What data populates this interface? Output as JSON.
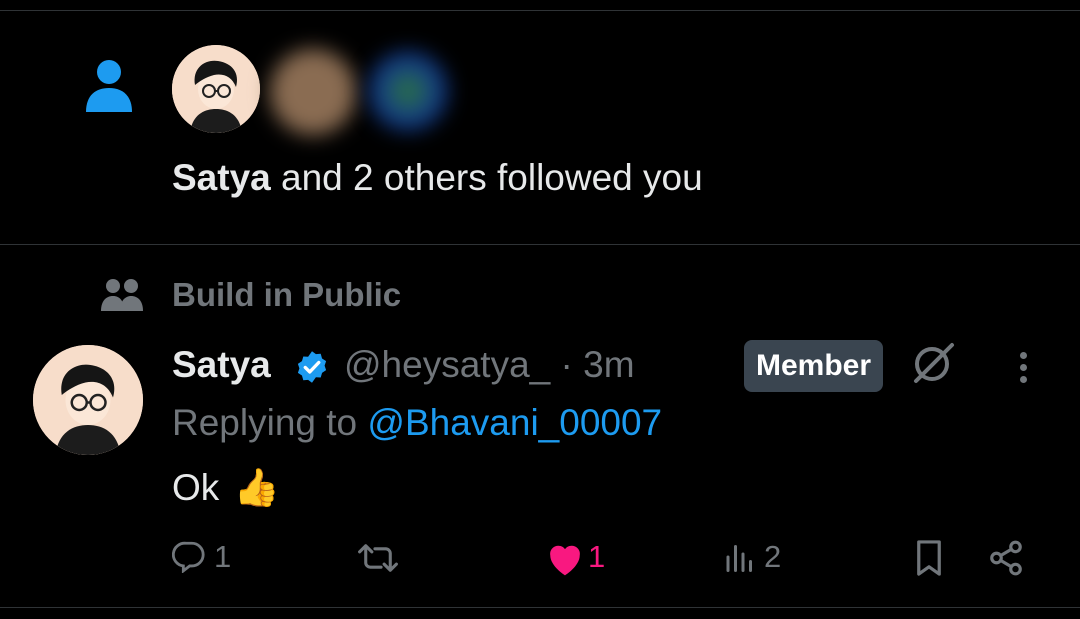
{
  "follow": {
    "user": "Satya",
    "rest": " and 2 others followed you"
  },
  "community": {
    "name": "Build in Public"
  },
  "post": {
    "author_name": "Satya",
    "handle": "@heysatya_",
    "separator": "·",
    "time": "3m",
    "badge": "Member",
    "replying_prefix": "Replying to ",
    "replying_to": "@Bhavani_00007",
    "text": "Ok",
    "emoji": "👍",
    "actions": {
      "reply_count": "1",
      "repost_count": "",
      "like_count": "1",
      "views_count": "2"
    }
  },
  "colors": {
    "background": "#000000",
    "text": "#e7e9ea",
    "muted": "#71767b",
    "accent": "#1d9bf0",
    "like": "#f91880",
    "badge_bg": "#3a4550"
  },
  "icons": [
    "person-icon",
    "community-icon",
    "verified-icon",
    "grok-icon",
    "more-icon",
    "reply-icon",
    "repost-icon",
    "heart-icon",
    "views-icon",
    "bookmark-icon",
    "share-icon"
  ]
}
